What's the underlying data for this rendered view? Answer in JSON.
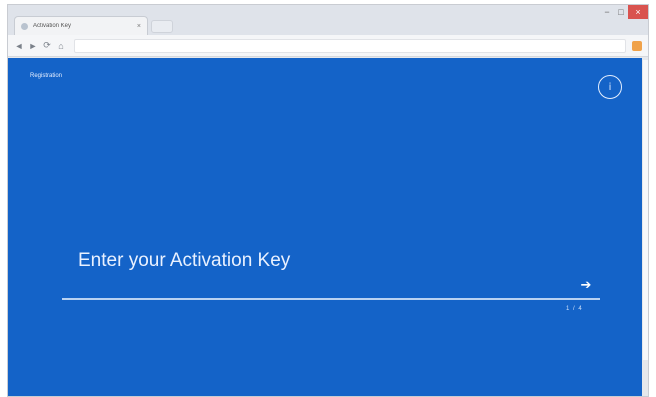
{
  "browser": {
    "tab_title": "Activation Key",
    "tab_close": "×",
    "back": "◄",
    "forward": "►",
    "refresh": "⟳",
    "home": "⌂",
    "minimize": "−",
    "maximize": "□",
    "close": "×"
  },
  "page": {
    "brand": "Registration",
    "help_glyph": "i",
    "prompt": "Enter your Activation Key",
    "submit_glyph": "➔",
    "pager": "1 / 4"
  },
  "colors": {
    "background": "#1463c8",
    "text": "#e9f1ff",
    "underline": "#b9d2f2"
  },
  "icons": [
    "back-arrow-icon",
    "forward-arrow-icon",
    "refresh-icon",
    "home-icon",
    "extension-icon",
    "info-icon",
    "arrow-right-icon"
  ]
}
